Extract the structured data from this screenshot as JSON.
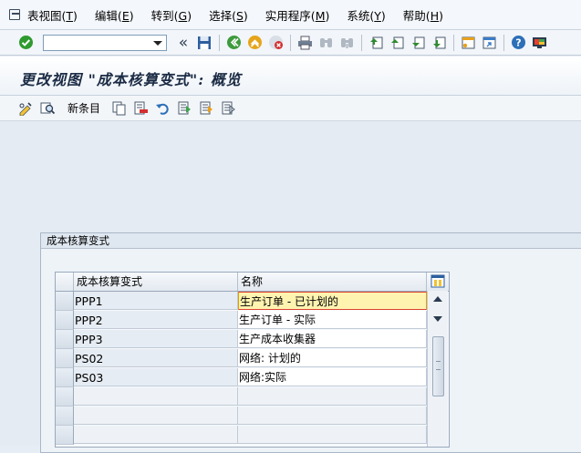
{
  "menu": {
    "items": [
      {
        "label": "表视图(",
        "acc": "T",
        "tail": ")"
      },
      {
        "label": "编辑(",
        "acc": "E",
        "tail": ")"
      },
      {
        "label": "转到(",
        "acc": "G",
        "tail": ")"
      },
      {
        "label": "选择(",
        "acc": "S",
        "tail": ")"
      },
      {
        "label": "实用程序(",
        "acc": "M",
        "tail": ")"
      },
      {
        "label": "系统(",
        "acc": "Y",
        "tail": ")"
      },
      {
        "label": "帮助(",
        "acc": "H",
        "tail": ")"
      }
    ]
  },
  "toolbar": {
    "command_value": "",
    "back_glyph": "«"
  },
  "title": "更改视图 \"成本核算变式\": 概览",
  "app_toolbar": {
    "new_entries": "新条目"
  },
  "group": {
    "title": "成本核算变式"
  },
  "table": {
    "columns": [
      "成本核算变式",
      "名称"
    ],
    "rows": [
      {
        "variant": "PPP1",
        "name": "生产订单 - 已计划的"
      },
      {
        "variant": "PPP2",
        "name": "生产订单 - 实际"
      },
      {
        "variant": "PPP3",
        "name": "生产成本收集器"
      },
      {
        "variant": "PS02",
        "name": "网络: 计划的"
      },
      {
        "variant": "PS03",
        "name": "网络:实际"
      }
    ]
  },
  "colors": {
    "accent_blue": "#1b2b44",
    "focus_fill": "#fff3b0",
    "ok_green": "#2f9a2f"
  }
}
